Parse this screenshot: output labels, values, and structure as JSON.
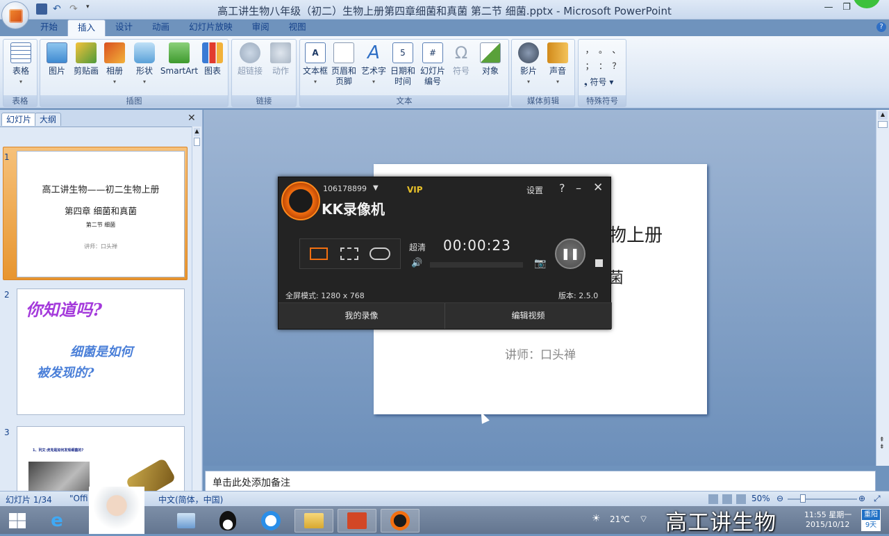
{
  "window": {
    "title": "高工讲生物八年级（初二）生物上册第四章细菌和真菌 第二节 细菌.pptx - Microsoft PowerPoint"
  },
  "ribbon_tabs": [
    "开始",
    "插入",
    "设计",
    "动画",
    "幻灯片放映",
    "审阅",
    "视图"
  ],
  "ribbon": {
    "groups": [
      {
        "label": "表格",
        "buttons": [
          "表格"
        ]
      },
      {
        "label": "插图",
        "buttons": [
          "图片",
          "剪贴画",
          "相册",
          "形状",
          "SmartArt",
          "图表"
        ]
      },
      {
        "label": "链接",
        "buttons": [
          "超链接",
          "动作"
        ]
      },
      {
        "label": "文本",
        "buttons": [
          "文本框",
          "页眉和\n页脚",
          "艺术字",
          "日期和\n时间",
          "幻灯片\n编号",
          "符号",
          "对象"
        ]
      },
      {
        "label": "媒体剪辑",
        "buttons": [
          "影片",
          "声音"
        ]
      },
      {
        "label": "特殊符号",
        "buttons": [
          "符号"
        ]
      }
    ],
    "special_symbols": [
      "，",
      "。",
      "、",
      "；",
      "：",
      "？"
    ]
  },
  "left_pane": {
    "tabs": [
      "幻灯片",
      "大纲"
    ],
    "slides": [
      {
        "num": "1",
        "line1": "高工讲生物——初二生物上册",
        "line2": "第四章 细菌和真菌",
        "line3": "第二节 细菌",
        "line4": "讲师：口头禅"
      },
      {
        "num": "2",
        "line1": "你知道吗?",
        "line2": "细菌是如何",
        "line3": "被发现的?"
      },
      {
        "num": "3",
        "line1": "1、列文·虎克是如何发现细菌的?"
      }
    ]
  },
  "slide": {
    "title_fragment": "物上册",
    "line2_fragment": "菌",
    "presenter": "讲师：口头禅"
  },
  "notes_placeholder": "单击此处添加备注",
  "status": {
    "slide": "幻灯片 1/34",
    "theme": "\"Offi",
    "lang": "中文(简体，中国)",
    "zoom": "50%"
  },
  "recorder": {
    "account": "106178899",
    "vip": "VIP",
    "brand": "KK录像机",
    "settings": "设置",
    "quality": "超清",
    "timer": "00:00:23",
    "mode": "全屏模式: 1280 x 768",
    "version": "版本: 2.5.0",
    "my_recordings": "我的录像",
    "edit_video": "编辑视频"
  },
  "taskbar": {
    "temperature": "21℃",
    "time": "11:55 星期一",
    "date": "2015/10/12",
    "weather_badge": "重阳",
    "weather_days": "9天"
  },
  "watermark": "高工讲生物",
  "colors": {
    "accent": "#f36f10",
    "ribbon": "#dfe9f6",
    "slide_bg": "#6f93bd"
  }
}
